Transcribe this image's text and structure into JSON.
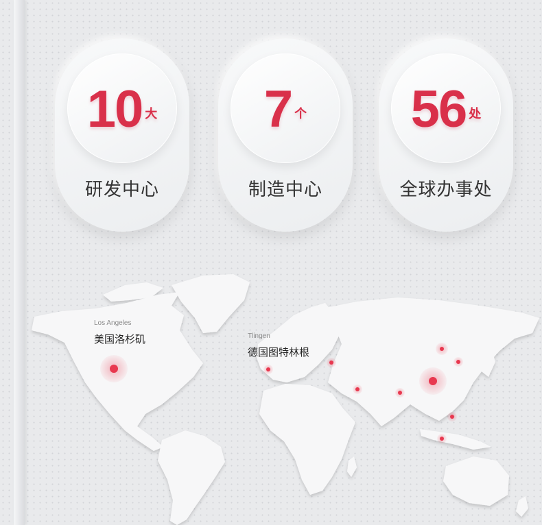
{
  "stats": [
    {
      "value": "10",
      "unit": "大",
      "label": "研发中心"
    },
    {
      "value": "7",
      "unit": "个",
      "label": "制造中心"
    },
    {
      "value": "56",
      "unit": "处",
      "label": "全球办事处"
    }
  ],
  "locations": [
    {
      "name_en": "Los Angeles",
      "name_cn": "美国洛杉矶"
    },
    {
      "name_en": "Tlingen",
      "name_cn": "德国图特林根"
    }
  ],
  "colors": {
    "accent": "#d9304a",
    "map_land": "#f7f7f8"
  }
}
